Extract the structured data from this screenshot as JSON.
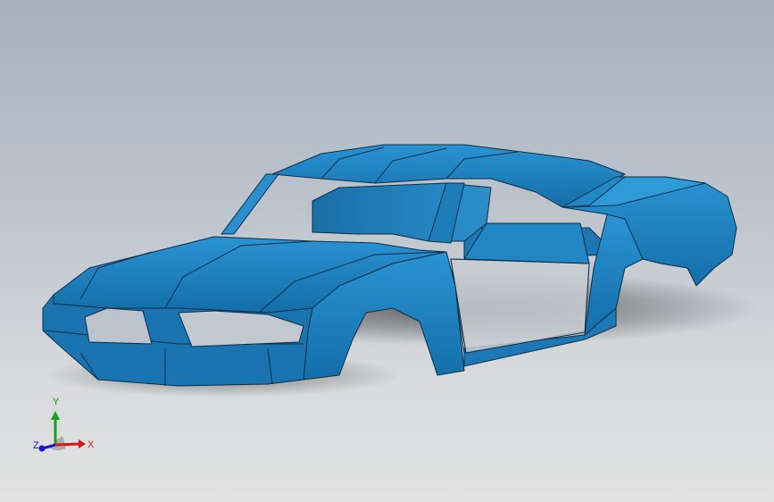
{
  "viewport": {
    "background_top": "#a6b0be",
    "background_bottom": "#e2e2e2",
    "model_color": "#1f7fbf",
    "model_edge_color": "#0b2f48"
  },
  "triad": {
    "x_label": "X",
    "y_label": "Y",
    "z_label": "Z",
    "x_color": "#d01818",
    "y_color": "#1aa01a",
    "z_color": "#1818c8"
  }
}
